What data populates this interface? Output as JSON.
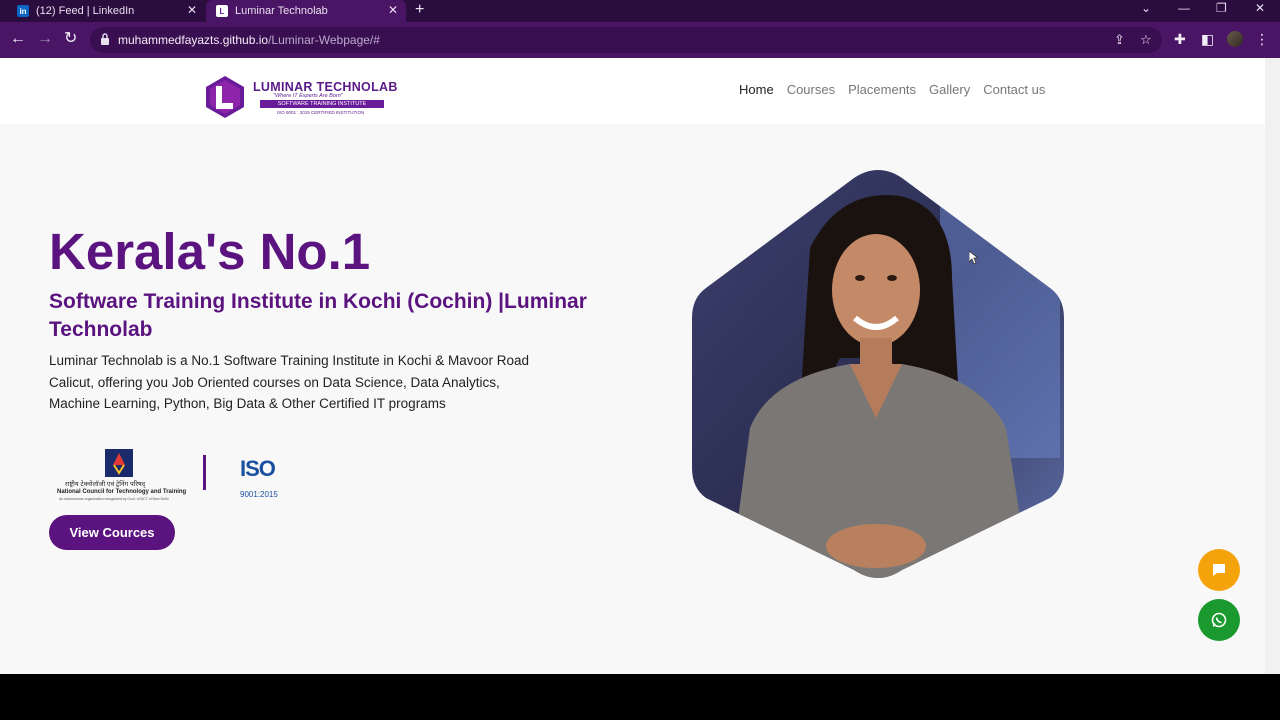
{
  "browser": {
    "tabs": [
      {
        "title": "(12) Feed | LinkedIn",
        "favicon": "linkedin-icon",
        "active": false
      },
      {
        "title": "Luminar Technolab",
        "favicon": "luminar-favicon",
        "active": true
      }
    ],
    "new_tab_label": "+",
    "url_host": "muhammedfayazts.github.io",
    "url_path": "/Luminar-Webpage/#",
    "theme_color": "#4b1566"
  },
  "site": {
    "logo": {
      "brand": "LUMINAR TECHNOLAB",
      "tagline": "\"Where IT Experts Are Born\"",
      "strip": "SOFTWARE TRAINING INSTITUTE",
      "iso_line": "ISO 9001 : 2015 CERTIFIED INSTITUTION"
    },
    "nav": [
      {
        "label": "Home",
        "active": true
      },
      {
        "label": "Courses",
        "active": false
      },
      {
        "label": "Placements",
        "active": false
      },
      {
        "label": "Gallery",
        "active": false
      },
      {
        "label": "Contact us",
        "active": false
      }
    ],
    "hero": {
      "title": "Kerala's No.1",
      "subtitle": "Software Training Institute in Kochi (Cochin) |Luminar Technolab",
      "description": "Luminar Technolab is a No.1 Software Training Institute in Kochi & Mavoor Road Calicut, offering you Job Oriented courses on Data Science, Data Analytics, Machine Learning, Python, Big Data & Other Certified IT programs",
      "cta_label": "View Cources"
    },
    "certifications": {
      "ncvt_hindi": "राष्ट्रीय टेक्नोलॉजी एवं ट्रेनिंग परिषद्",
      "ncvt_english": "National Council for Technology and Training",
      "ncvt_small": "An autonomous organization recognised by Govt. of NCT of New Delhi",
      "iso_text": "ISO",
      "iso_number": "9001:2015"
    },
    "colors": {
      "primary": "#5b137f",
      "chat_fab": "#f5a30a",
      "whatsapp_fab": "#1a9a2e"
    }
  }
}
